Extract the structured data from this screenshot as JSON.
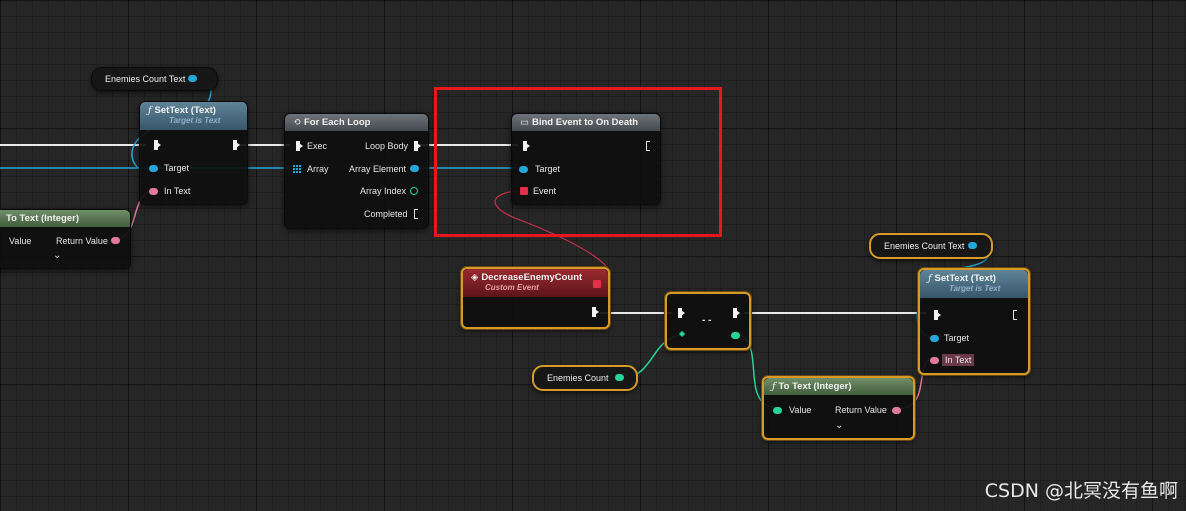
{
  "var_enemies_count_text_left": {
    "label": "Enemies Count Text"
  },
  "settext_left": {
    "title": "SetText (Text)",
    "subtitle": "Target is Text",
    "icon": "function-icon",
    "target": "Target",
    "in_text": "In Text"
  },
  "totext_left": {
    "title": "To Text (Integer)",
    "value": "Value",
    "return_value": "Return Value",
    "chevron": "⌄"
  },
  "foreach": {
    "title": "For Each Loop",
    "exec": "Exec",
    "array": "Array",
    "loop_body": "Loop Body",
    "array_element": "Array Element",
    "array_index": "Array Index",
    "completed": "Completed"
  },
  "bind_event": {
    "title": "Bind Event to On Death",
    "target": "Target",
    "event": "Event"
  },
  "custom_event": {
    "title": "DecreaseEnemyCount",
    "subtitle": "Custom Event"
  },
  "compare": {
    "op": "- -"
  },
  "var_enemies_count": {
    "label": "Enemies Count"
  },
  "var_enemies_count_text_right": {
    "label": "Enemies Count Text"
  },
  "settext_right": {
    "title": "SetText (Text)",
    "subtitle": "Target is Text",
    "icon": "function-icon",
    "target": "Target",
    "in_text": "In Text"
  },
  "totext_right": {
    "title": "To Text (Integer)",
    "value": "Value",
    "return_value": "Return Value",
    "chevron": "⌄"
  },
  "watermark": "CSDN @北冥没有鱼啊",
  "colors": {
    "exec": "#f2f2f2",
    "object_pin": "#25a6d8",
    "text_pin": "#e07a98",
    "int_pin": "#26d39a",
    "event_pin": "#e0304a",
    "selection": "#d69a28",
    "highlight_box": "#e8171b"
  }
}
